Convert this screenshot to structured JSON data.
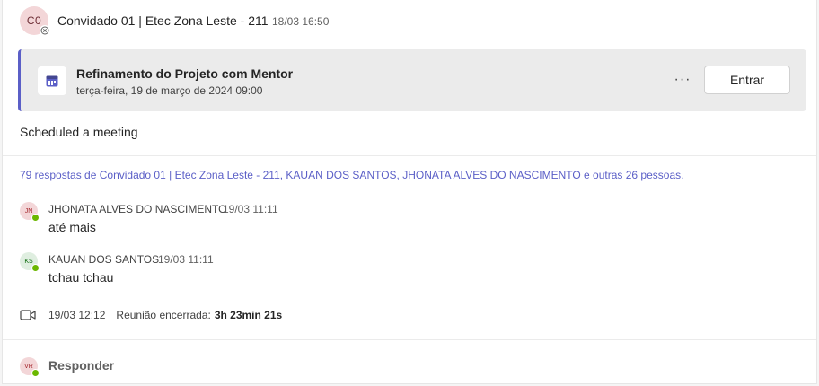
{
  "post": {
    "author_initials": "C0",
    "author_name": "Convidado 01 | Etec Zona Leste - 211",
    "timestamp": "18/03 16:50",
    "text": "Scheduled a meeting"
  },
  "meeting": {
    "title": "Refinamento do Projeto com Mentor",
    "datetime": "terça-feira, 19 de março de 2024 09:00",
    "more_label": "···",
    "join_label": "Entrar",
    "accent_color": "#5b5fc7"
  },
  "replies_summary": "79 respostas de Convidado 01 | Etec Zona Leste - 211, KAUAN DOS SANTOS, JHONATA ALVES DO NASCIMENTO e outras 26 pessoas.",
  "replies": [
    {
      "initials": "JN",
      "name": "JHONATA ALVES DO NASCIMENTO",
      "time": "19/03 11:11",
      "text": "até mais"
    },
    {
      "initials": "KS",
      "name": "KAUAN DOS SANTOS",
      "time": "19/03 11:11",
      "text": "tchau tchau"
    }
  ],
  "meeting_ended": {
    "time": "19/03 12:12",
    "label": "Reunião encerrada:",
    "duration": "3h 23min 21s"
  },
  "reply_box": {
    "initials": "VR",
    "label": "Responder"
  }
}
